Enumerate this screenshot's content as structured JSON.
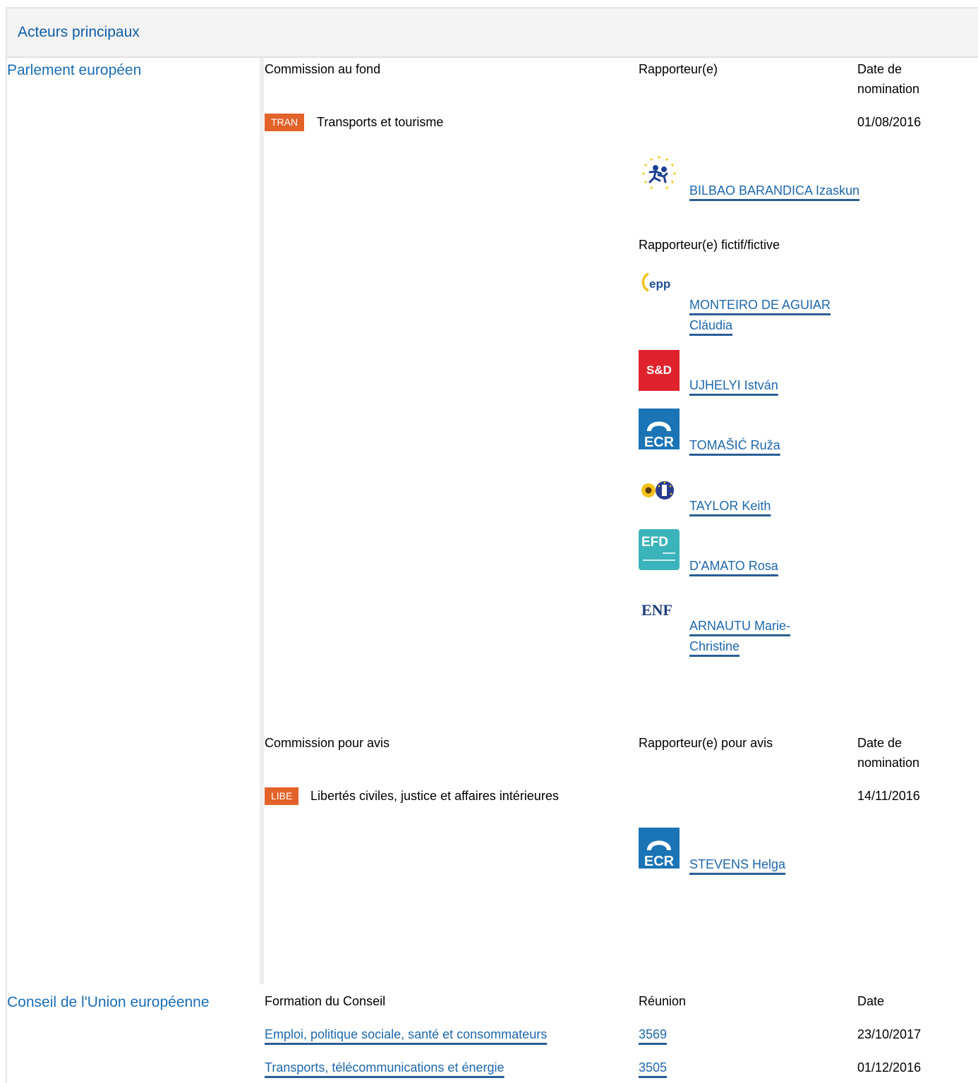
{
  "header": {
    "title": "Acteurs principaux"
  },
  "parliament": {
    "title": "Parlement européen",
    "lead": {
      "col_committee": "Commission au fond",
      "col_rapporteur": "Rapporteur(e)",
      "col_date": "Date de nomination",
      "committee_tag": "TRAN",
      "committee_name": "Transports et tourisme",
      "date": "01/08/2016",
      "rapporteur": {
        "name": "BILBAO BARANDICA Izaskun",
        "group_logo": "alde-logo"
      },
      "shadow_label": "Rapporteur(e) fictif/fictive",
      "shadows": [
        {
          "name": "MONTEIRO DE AGUIAR Cláudia",
          "group_logo": "epp-logo",
          "logo_text": "epp"
        },
        {
          "name": "UJHELYI István",
          "group_logo": "sd-logo",
          "logo_text": "S&D"
        },
        {
          "name": "TOMAŠIĆ Ruža",
          "group_logo": "ecr-logo",
          "logo_text": "ECR"
        },
        {
          "name": "TAYLOR Keith",
          "group_logo": "greens-efa-logo"
        },
        {
          "name": "D'AMATO Rosa",
          "group_logo": "efdd-logo",
          "logo_text": "EFD"
        },
        {
          "name": "ARNAUTU Marie-Christine",
          "group_logo": "enf-logo",
          "logo_text": "ENF"
        }
      ]
    },
    "opinion": {
      "col_committee": "Commission pour avis",
      "col_rapporteur": "Rapporteur(e) pour avis",
      "col_date": "Date de nomination",
      "committee_tag": "LIBE",
      "committee_name": "Libertés civiles, justice et affaires intérieures",
      "date": "14/11/2016",
      "rapporteur": {
        "name": "STEVENS Helga",
        "group_logo": "ecr-logo",
        "logo_text": "ECR"
      }
    }
  },
  "council": {
    "title": "Conseil de l'Union européenne",
    "col_formation": "Formation du Conseil",
    "col_meeting": "Réunion",
    "col_date": "Date",
    "rows": [
      {
        "formation": "Emploi, politique sociale, santé et consommateurs",
        "meeting": "3569",
        "date": "23/10/2017"
      },
      {
        "formation": "Transports, télécommunications et énergie",
        "meeting": "3505",
        "date": "01/12/2016"
      }
    ]
  },
  "colors": {
    "link": "#1d67ad",
    "title": "#1a6db5",
    "tag": "#e2622a",
    "ecr": "#1a74b5",
    "sd": "#e0222d",
    "efd": "#3ab3ba"
  }
}
